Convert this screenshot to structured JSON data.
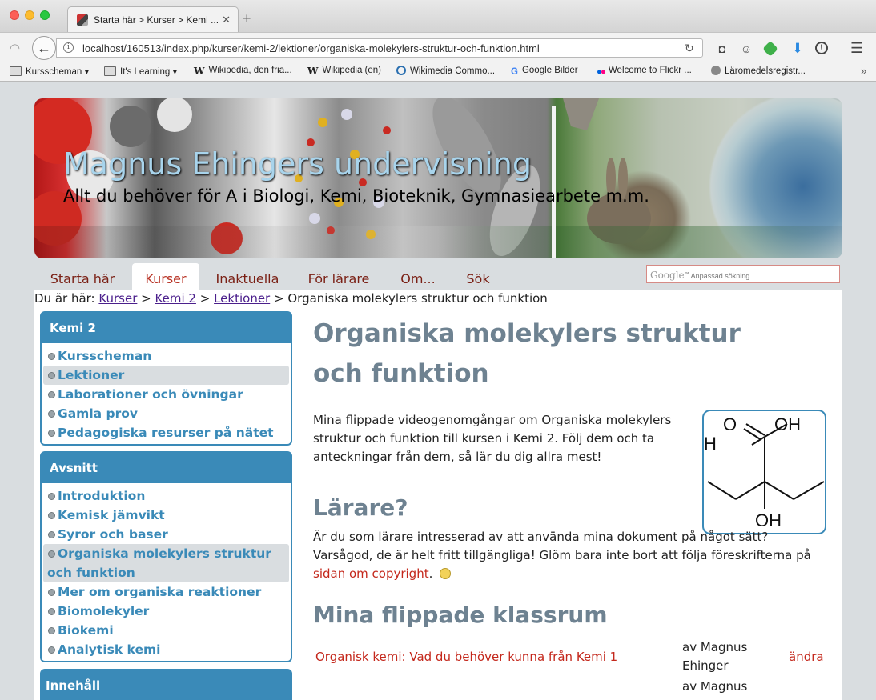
{
  "browser": {
    "tab_title": "Starta här > Kurser > Kemi ...",
    "url": "localhost/160513/index.php/kurser/kemi-2/lektioner/organiska-molekylers-struktur-och-funktion.html",
    "bookmarks": [
      {
        "label": "Kursscheman",
        "icon": "folder-icon"
      },
      {
        "label": "It's Learning",
        "icon": "folder-icon"
      },
      {
        "label": "Wikipedia, den fria...",
        "icon": "wikipedia-icon"
      },
      {
        "label": "Wikipedia (en)",
        "icon": "wikipedia-icon"
      },
      {
        "label": "Wikimedia Commo...",
        "icon": "wikimedia-icon"
      },
      {
        "label": "Google Bilder",
        "icon": "google-icon"
      },
      {
        "label": "Welcome to Flickr ...",
        "icon": "flickr-icon"
      },
      {
        "label": "Läromedelsregistr...",
        "icon": "globe-icon"
      }
    ]
  },
  "site": {
    "title": "Magnus Ehingers undervisning",
    "subtitle": "Allt du behöver för A i Biologi, Kemi, Bioteknik, Gymnasiearbete m.m."
  },
  "nav": {
    "items": [
      "Starta här",
      "Kurser",
      "Inaktuella",
      "För lärare",
      "Om...",
      "Sök"
    ],
    "active": "Kurser",
    "search_placeholder": "Anpassad sökning",
    "search_brand": "Google"
  },
  "breadcrumb": {
    "prefix": "Du är här:",
    "links": [
      "Kurser",
      "Kemi 2",
      "Lektioner"
    ],
    "sep": ">",
    "current": "Organiska molekylers struktur och funktion"
  },
  "sidebar": {
    "kemi2": {
      "title": "Kemi 2",
      "items": [
        "Kursscheman",
        "Lektioner",
        "Laborationer och övningar",
        "Gamla prov",
        "Pedagogiska resurser på nätet"
      ]
    },
    "avsnitt": {
      "title": "Avsnitt",
      "items": [
        "Introduktion",
        "Kemisk jämvikt",
        "Syror och baser",
        "Organiska molekylers struktur och funktion",
        "Mer om organiska reaktioner",
        "Biomolekyler",
        "Biokemi",
        "Analytisk kemi"
      ]
    },
    "innehall": {
      "title": "Innehåll"
    }
  },
  "article": {
    "title": "Organiska molekylers struktur och funktion",
    "intro": "Mina flippade videogenomgångar om Organiska molekylers struktur och funktion till kursen i Kemi 2. Följ dem och ta anteckningar från dem, så lär du dig allra mest!",
    "h_teachers": "Lärare?",
    "teachers_text_1": "Är du som lärare intresserad av att använda mina dokument på något sätt? Varsågod, de är helt fritt tillgängliga! Glöm bara inte bort att följa föreskrifterna på ",
    "teachers_link": "sidan om copyright",
    "teachers_text_2": ".",
    "h_flipped": "Mina flippade klassrum",
    "videos": [
      {
        "title": "Organisk kemi: Vad du behöver kunna från Kemi 1",
        "author": "av Magnus Ehinger",
        "action": "ändra"
      },
      {
        "title": "",
        "author": "av Magnus",
        "action": ""
      }
    ],
    "molecule_labels": [
      "O",
      "OH",
      "H",
      "OH"
    ]
  },
  "colors": {
    "accent": "#3a8ab8",
    "heading": "#6e8291",
    "link": "#c4281c",
    "nav_text": "#7a1f14"
  }
}
